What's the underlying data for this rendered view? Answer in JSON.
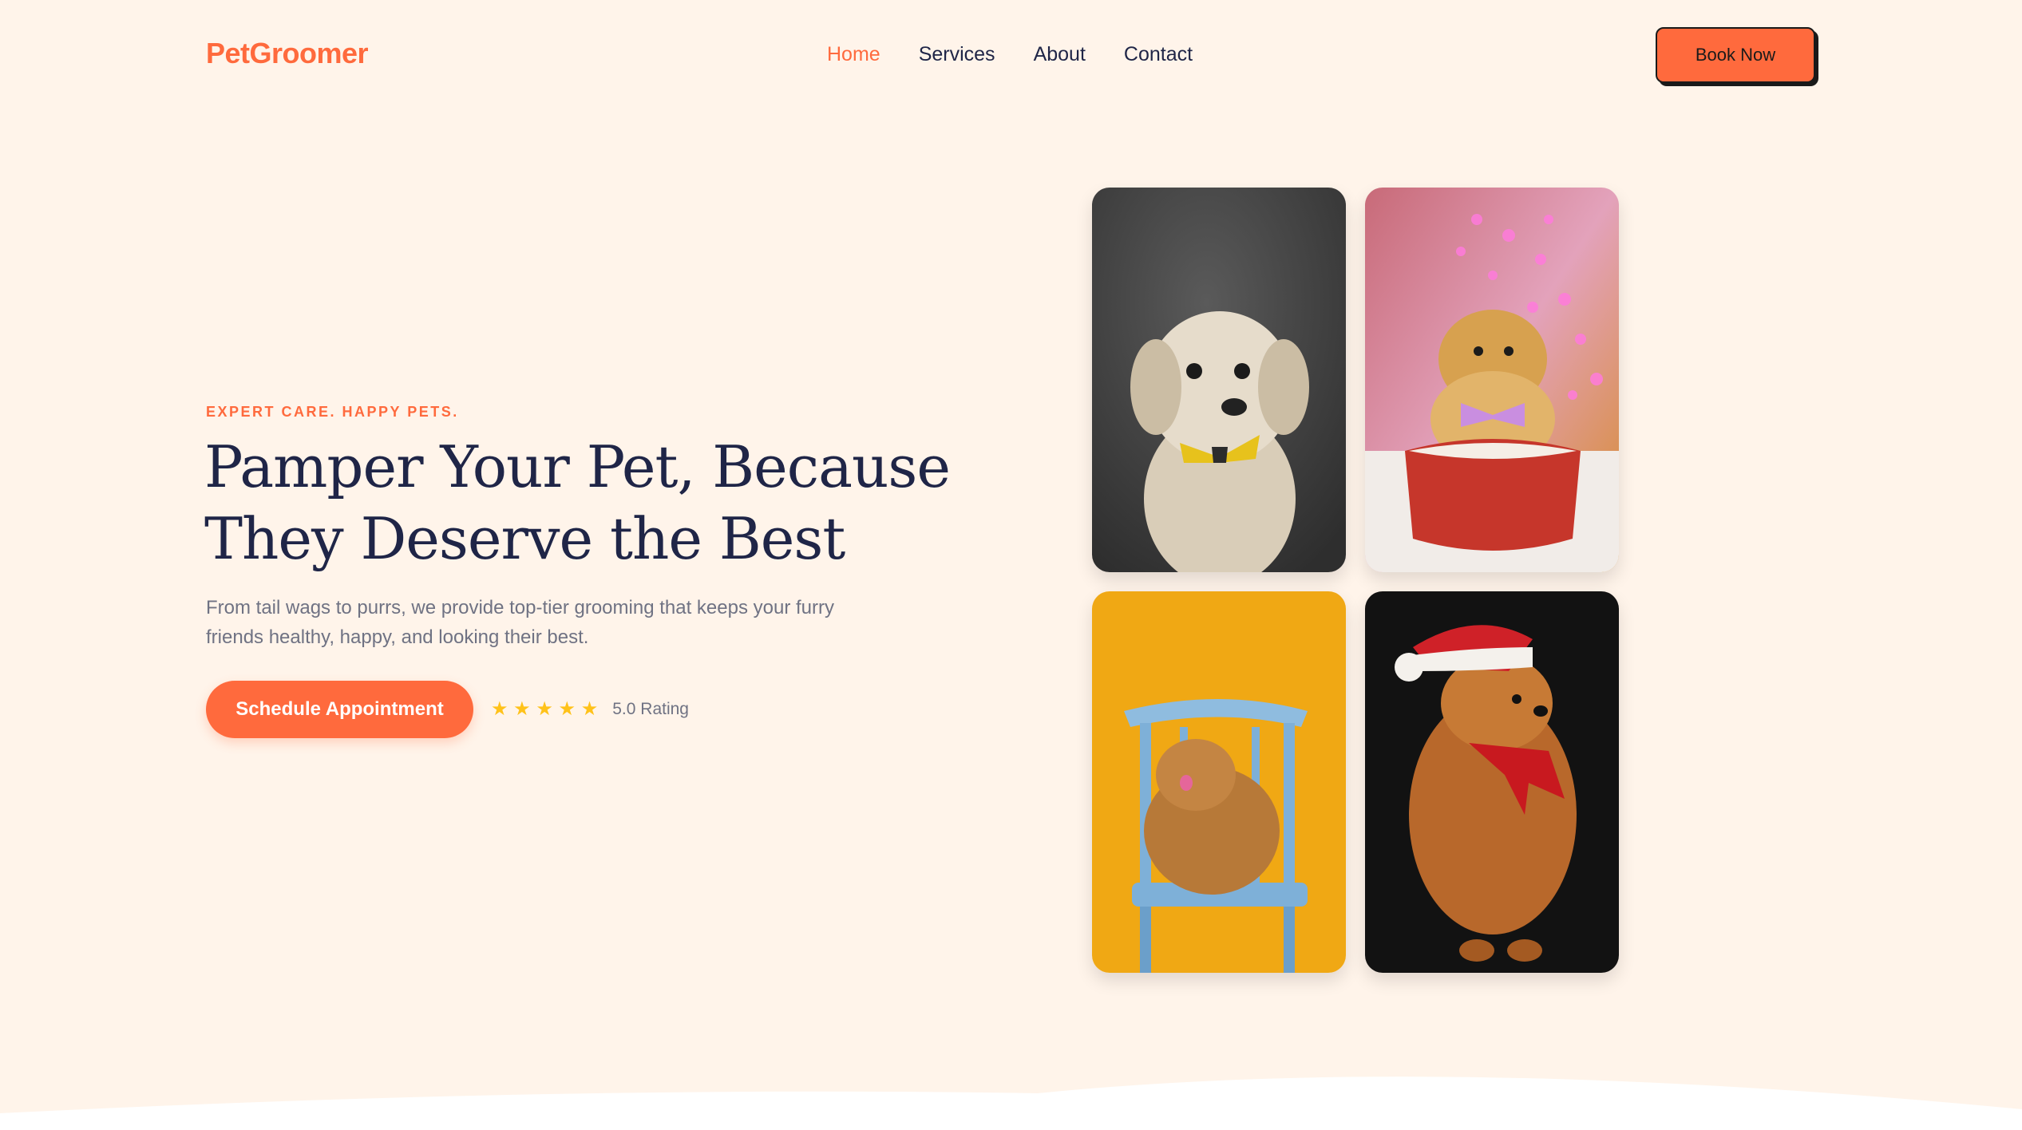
{
  "header": {
    "logo": "PetGroomer",
    "nav": [
      "Home",
      "Services",
      "About",
      "Contact"
    ],
    "active_nav": "Home",
    "book_button": "Book Now"
  },
  "hero": {
    "tagline": "EXPERT CARE. HAPPY PETS.",
    "headline_line1": "Pamper Your Pet, Because",
    "headline_line2": "They Deserve the Best",
    "description": "From tail wags to purrs, we provide top-tier grooming that keeps your furry friends healthy, happy, and looking their best.",
    "cta_button": "Schedule Appointment",
    "rating_stars": "★ ★ ★ ★ ★",
    "rating_value": 5.0,
    "rating_text": "5.0 Rating"
  },
  "gallery": [
    {
      "name": "white-dog-with-yellow-bowtie-photo",
      "background": "#4a4a4a"
    },
    {
      "name": "pomeranian-in-red-box-photo",
      "background": "#e59ab8"
    },
    {
      "name": "pomeranian-on-blue-chair-photo",
      "background": "#f0a814"
    },
    {
      "name": "pomeranian-santa-hat-photo",
      "background": "#121212"
    }
  ],
  "colors": {
    "background": "#fff4ea",
    "accent": "#ff6a3d",
    "heading": "#1f2547",
    "body_text": "#6f7283",
    "star": "#ffc21a"
  }
}
